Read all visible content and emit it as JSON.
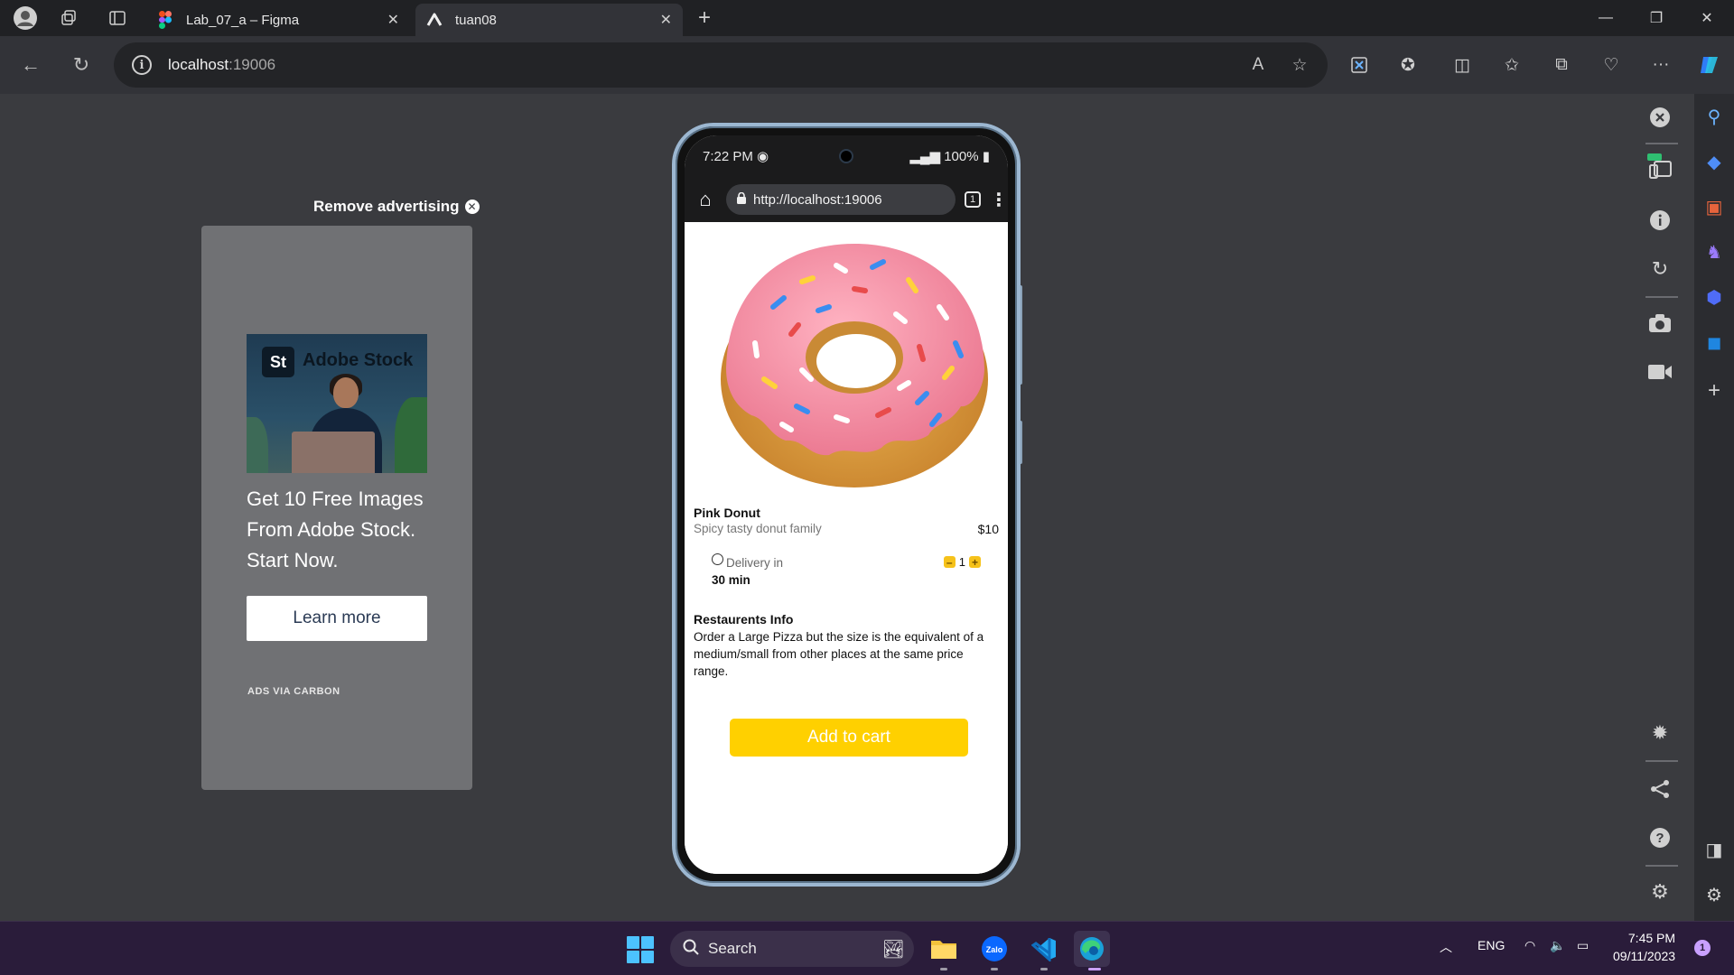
{
  "browser": {
    "tabs": [
      {
        "title": "Lab_07_a – Figma",
        "icon": "figma-icon",
        "active": false
      },
      {
        "title": "tuan08",
        "icon": "expo-icon",
        "active": true
      }
    ],
    "address": {
      "host": "localhost",
      "port": ":19006"
    }
  },
  "ad": {
    "remove_label": "Remove advertising",
    "brand": "Adobe Stock",
    "logo_text": "St",
    "headline": "Get 10 Free Images From Adobe Stock. Start Now.",
    "cta": "Learn more",
    "via": "ADS VIA CARBON"
  },
  "phone": {
    "status": {
      "time": "7:22 PM",
      "battery": "100%"
    },
    "url": "http://localhost:19006",
    "tab_count": "1",
    "product": {
      "name": "Pink Donut",
      "subtitle": "Spicy tasty donut family",
      "price": "$10",
      "delivery_label": "Delivery in",
      "delivery_time": "30 min",
      "quantity": "1",
      "info_title": "Restaurents Info",
      "info_body": "Order a Large Pizza but the size is the equivalent of a medium/small from other places at the same price range.",
      "cta": "Add to cart"
    }
  },
  "taskbar": {
    "search_label": "Search",
    "language": "ENG",
    "time": "7:45 PM",
    "date": "09/11/2023",
    "notifications": "1"
  },
  "colors": {
    "accent_yellow": "#ffd000",
    "donut_icing": "#f58ea3",
    "page_bg": "#3a3b3f"
  }
}
